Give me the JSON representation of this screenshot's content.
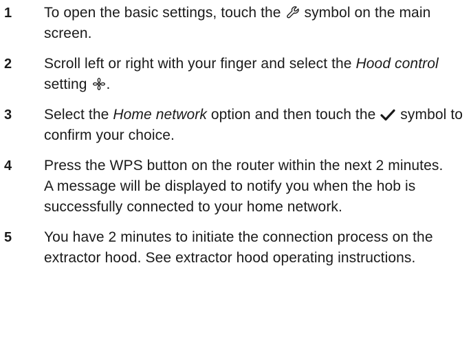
{
  "steps": [
    {
      "number": "1",
      "text_before_icon": "To open the basic settings, touch the",
      "icon": "wrench-icon",
      "text_after_icon": "symbol on the main screen."
    },
    {
      "number": "2",
      "text_plain": "Scroll left or right with your finger and select the",
      "emphasis": "Hood control",
      "text_after_emphasis": "setting",
      "icon": "fan-icon",
      "end": "."
    },
    {
      "number": "3",
      "text_before_emphasis": "Select the",
      "emphasis": "Home network",
      "text_after_emphasis": "option and then touch the",
      "icon": "checkmark-icon",
      "text_after_icon": "symbol to confirm your choice."
    },
    {
      "number": "4",
      "line1": "Press the WPS button on the router within the next 2 minutes.",
      "line2": "A message will be displayed to notify you when the hob is successfully connected to your home network."
    },
    {
      "number": "5",
      "text": "You have 2 minutes to initiate the connection process on the extractor hood. See extractor hood operating instructions."
    }
  ]
}
